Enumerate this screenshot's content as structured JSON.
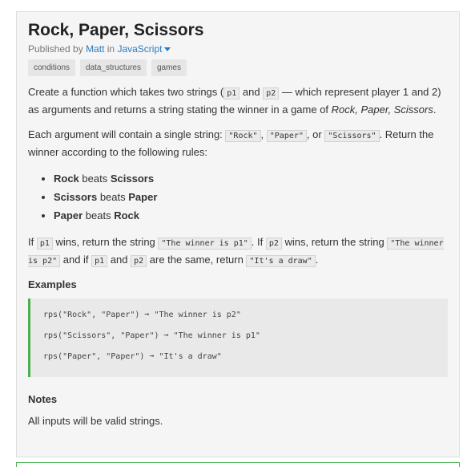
{
  "challenge": {
    "title": "Rock, Paper, Scissors",
    "published_prefix": "Published by",
    "author": "Matt",
    "in_word": "in",
    "language": "JavaScript",
    "tags": [
      "conditions",
      "data_structures",
      "games"
    ]
  },
  "description": {
    "p1_a": "Create a function which takes two strings (",
    "p1_code1": "p1",
    "p1_b": " and ",
    "p1_code2": "p2",
    "p1_c": " — which represent player 1 and 2) as arguments and returns a string stating the winner in a game of ",
    "p1_em": "Rock, Paper, Scissors",
    "p1_d": ".",
    "p2_a": "Each argument will contain a single string: ",
    "p2_code1": "\"Rock\"",
    "p2_b": ", ",
    "p2_code2": "\"Paper\"",
    "p2_c": ", or ",
    "p2_code3": "\"Scissors\"",
    "p2_d": ". Return the winner according to the following rules:",
    "rules": [
      {
        "a": "Rock",
        "verb": "beats",
        "b": "Scissors"
      },
      {
        "a": "Scissors",
        "verb": "beats",
        "b": "Paper"
      },
      {
        "a": "Paper",
        "verb": "beats",
        "b": "Rock"
      }
    ],
    "p3_a": "If ",
    "p3_code1": "p1",
    "p3_b": " wins, return the string ",
    "p3_code2": "\"The winner is p1\"",
    "p3_c": ". If ",
    "p3_code3": "p2",
    "p3_d": " wins, return the string ",
    "p3_code4": "\"The winner is p2\"",
    "p3_e": " and if ",
    "p3_code5": "p1",
    "p3_f": " and ",
    "p3_code6": "p2",
    "p3_g": " are the same, return ",
    "p3_code7": "\"It's a draw\"",
    "p3_h": "."
  },
  "examples": {
    "title": "Examples",
    "lines": [
      "rps(\"Rock\", \"Paper\") ➞ \"The winner is p2\"",
      "rps(\"Scissors\", \"Paper\") ➞ \"The winner is p1\"",
      "rps(\"Paper\", \"Paper\") ➞ \"It's a draw\""
    ]
  },
  "notes": {
    "title": "Notes",
    "text": "All inputs will be valid strings."
  },
  "colors": {
    "link": "#2a7bbf",
    "accent": "#4caf50"
  }
}
